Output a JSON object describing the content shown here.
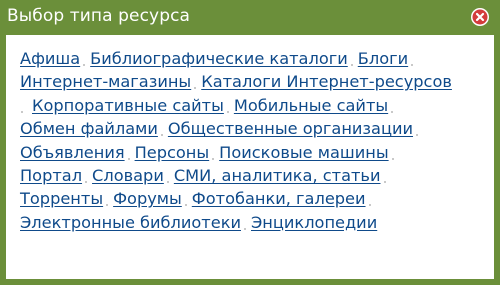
{
  "dialog": {
    "title": "Выбор типа ресурса",
    "close_icon": "close-icon",
    "colors": {
      "frame": "#6b8f3a",
      "link": "#0f4a8a",
      "close": "#d33b3b"
    }
  },
  "resource_types": [
    "Афиша",
    "Библиографические каталоги",
    "Блоги",
    "Интернет-магазины",
    "Каталоги Интернет-ресурсов",
    "Корпоративные сайты",
    "Мобильные сайты",
    "Обмен файлами",
    "Общественные организации",
    "Объявления",
    "Персоны",
    "Поисковые машины",
    "Портал",
    "Словари",
    "СМИ, аналитика, статьи",
    "Торренты",
    "Форумы",
    "Фотобанки, галереи",
    "Электронные библиотеки",
    "Энциклопедии"
  ]
}
